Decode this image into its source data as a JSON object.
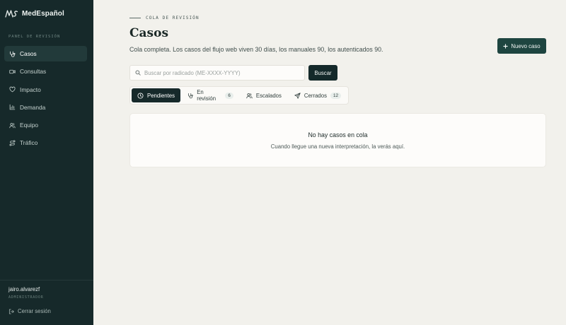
{
  "brand": {
    "name": "MedEspañol",
    "icon": "ms-logo-icon"
  },
  "sidebar": {
    "section_label": "PANEL DE REVISIÓN",
    "items": [
      {
        "label": "Casos",
        "icon": "stethoscope-icon",
        "active": true
      },
      {
        "label": "Consultas",
        "icon": "video-icon",
        "active": false
      },
      {
        "label": "Impacto",
        "icon": "heart-icon",
        "active": false
      },
      {
        "label": "Demanda",
        "icon": "bar-chart-icon",
        "active": false
      },
      {
        "label": "Equipo",
        "icon": "users-icon",
        "active": false
      },
      {
        "label": "Tráfico",
        "icon": "route-icon",
        "active": false
      }
    ],
    "user": {
      "name": "jairo.alvarezf",
      "role": "ADMINISTRADOR"
    },
    "logout_label": "Cerrar sesión"
  },
  "header": {
    "eyebrow": "COLA DE REVISIÓN",
    "title": "Casos",
    "subtitle": "Cola completa. Los casos del flujo web viven 30 días, los manuales 90, los autenticados 90.",
    "new_case_label": "Nuevo caso"
  },
  "search": {
    "placeholder": "Buscar por radicado (ME-XXXX-YYYY)",
    "value": "",
    "button_label": "Buscar"
  },
  "tabs": [
    {
      "label": "Pendientes",
      "icon": "clock-icon",
      "count": "",
      "active": true
    },
    {
      "label": "En revisión",
      "icon": "stethoscope-icon",
      "count": "6",
      "active": false
    },
    {
      "label": "Escalados",
      "icon": "users-icon",
      "count": "",
      "active": false
    },
    {
      "label": "Cerrados",
      "icon": "send-icon",
      "count": "12",
      "active": false
    }
  ],
  "empty_state": {
    "title": "No hay casos en cola",
    "description": "Cuando llegue una nueva interpretación, la verás aquí."
  },
  "colors": {
    "sidebar_bg": "#16292a",
    "accent": "#1e4540",
    "page_bg": "#f2f1ec"
  }
}
